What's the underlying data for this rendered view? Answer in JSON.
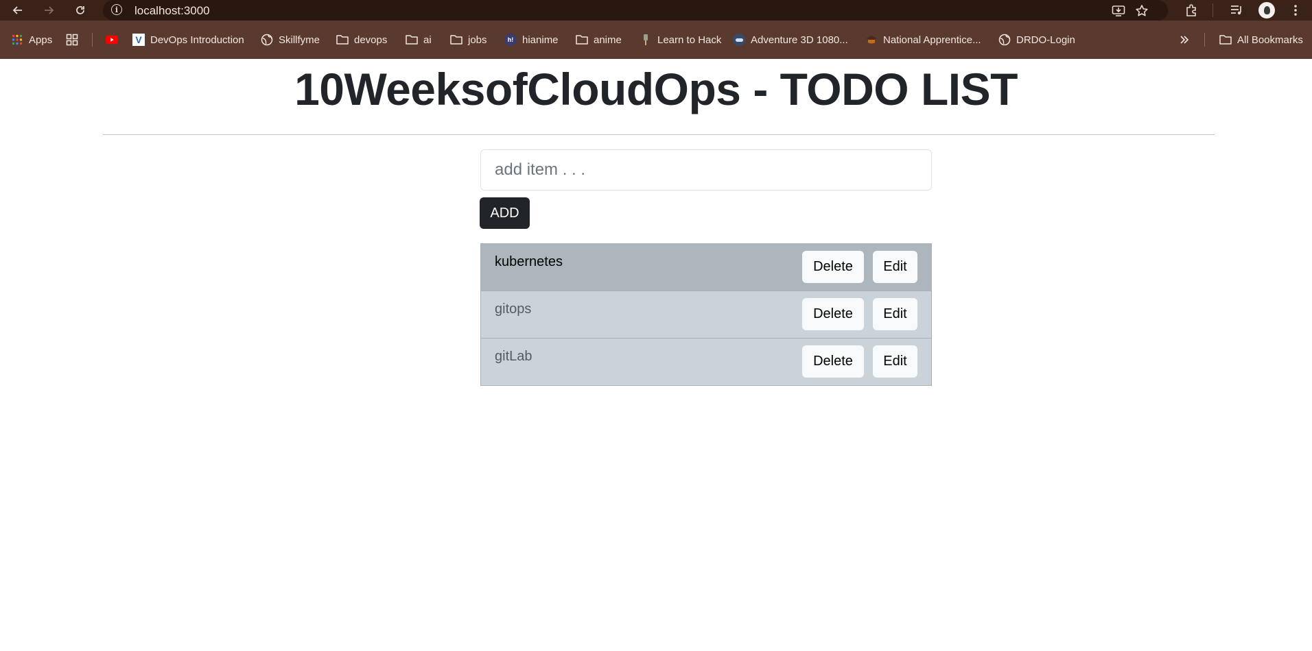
{
  "browser": {
    "url": "localhost:3000",
    "bookmarks": [
      {
        "label": "Apps",
        "icon": "apps-grid-icon"
      },
      {
        "label": "",
        "icon": "tab-groups-icon"
      },
      {
        "label": "",
        "icon": "youtube-icon"
      },
      {
        "label": "DevOps Introduction",
        "icon": "v-logo-icon"
      },
      {
        "label": "Skillfyme",
        "icon": "globe-icon"
      },
      {
        "label": "devops",
        "icon": "folder-icon"
      },
      {
        "label": "ai",
        "icon": "folder-icon"
      },
      {
        "label": "jobs",
        "icon": "folder-icon"
      },
      {
        "label": "hianime",
        "icon": "hianime-icon"
      },
      {
        "label": "anime",
        "icon": "folder-icon"
      },
      {
        "label": "Learn to Hack",
        "icon": "hack-icon"
      },
      {
        "label": "Adventure 3D 1080...",
        "icon": "adventure-icon"
      },
      {
        "label": "National Apprentice...",
        "icon": "apprentice-icon"
      },
      {
        "label": "DRDO-Login",
        "icon": "globe-icon"
      }
    ],
    "all_bookmarks_label": "All Bookmarks",
    "hianime_badge": "h!"
  },
  "page": {
    "title": "10WeeksofCloudOps - TODO LIST",
    "input_placeholder": "add item . . .",
    "add_label": "ADD",
    "items": [
      {
        "text": "kubernetes",
        "delete_label": "Delete",
        "edit_label": "Edit"
      },
      {
        "text": "gitops",
        "delete_label": "Delete",
        "edit_label": "Edit"
      },
      {
        "text": "gitLab",
        "delete_label": "Delete",
        "edit_label": "Edit"
      }
    ]
  },
  "colors": {
    "chrome_top": "#3b2219",
    "bookmark_bar": "#5a3a2e",
    "title": "#212529",
    "add_button": "#212529",
    "item_active": "#adb5bd",
    "item": "#cbd3da"
  }
}
